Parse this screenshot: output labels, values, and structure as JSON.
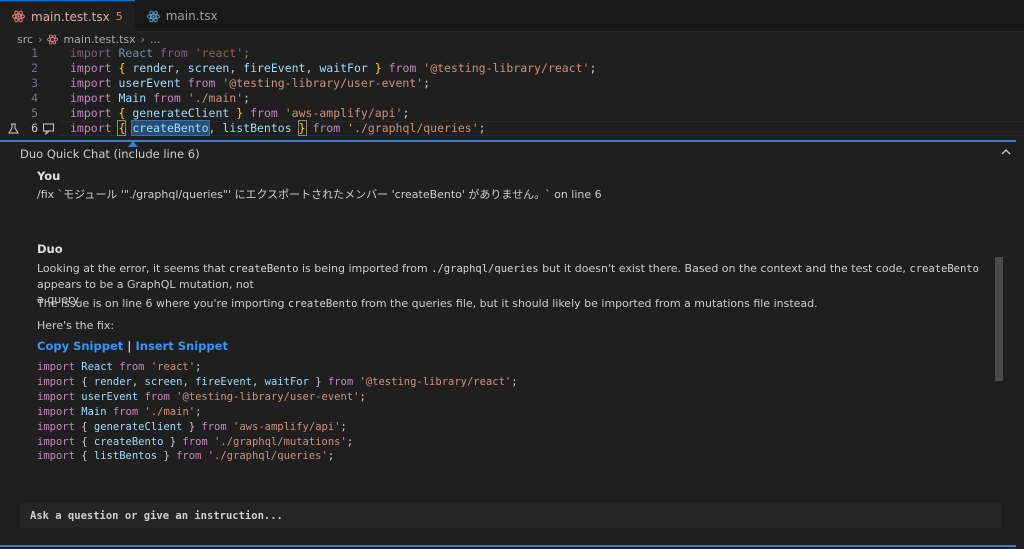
{
  "tabs": [
    {
      "label": "main.test.tsx",
      "badge": "5",
      "icon": "react-icon",
      "active": true
    },
    {
      "label": "main.tsx",
      "icon": "react-icon",
      "active": false
    }
  ],
  "breadcrumb": {
    "folder": "src",
    "file": "main.test.tsx",
    "more": "..."
  },
  "editor": {
    "lines": [
      {
        "n": "1",
        "tokens": [
          [
            "kw",
            "import"
          ],
          [
            "pl",
            " "
          ],
          [
            "id",
            "React"
          ],
          [
            "pl",
            " "
          ],
          [
            "kw",
            "from"
          ],
          [
            "pl",
            " "
          ],
          [
            "str",
            "'react'"
          ],
          [
            "pl",
            ";"
          ]
        ]
      },
      {
        "n": "2",
        "tokens": [
          [
            "kw",
            "import"
          ],
          [
            "pl",
            " "
          ],
          [
            "br",
            "{"
          ],
          [
            "pl",
            " "
          ],
          [
            "id",
            "render"
          ],
          [
            "pl",
            ", "
          ],
          [
            "id",
            "screen"
          ],
          [
            "pl",
            ", "
          ],
          [
            "id",
            "fireEvent"
          ],
          [
            "pl",
            ", "
          ],
          [
            "id",
            "waitFor"
          ],
          [
            "pl",
            " "
          ],
          [
            "br",
            "}"
          ],
          [
            "pl",
            " "
          ],
          [
            "kw",
            "from"
          ],
          [
            "pl",
            " "
          ],
          [
            "str",
            "'@testing-library/react'"
          ],
          [
            "pl",
            ";"
          ]
        ]
      },
      {
        "n": "3",
        "tokens": [
          [
            "kw",
            "import"
          ],
          [
            "pl",
            " "
          ],
          [
            "id",
            "userEvent"
          ],
          [
            "pl",
            " "
          ],
          [
            "kw",
            "from"
          ],
          [
            "pl",
            " "
          ],
          [
            "str",
            "'@testing-library/user-event'"
          ],
          [
            "pl",
            ";"
          ]
        ]
      },
      {
        "n": "4",
        "tokens": [
          [
            "kw",
            "import"
          ],
          [
            "pl",
            " "
          ],
          [
            "id",
            "Main"
          ],
          [
            "pl",
            " "
          ],
          [
            "kw",
            "from"
          ],
          [
            "pl",
            " "
          ],
          [
            "str",
            "'./main'"
          ],
          [
            "pl",
            ";"
          ]
        ]
      },
      {
        "n": "5",
        "tokens": [
          [
            "kw",
            "import"
          ],
          [
            "pl",
            " "
          ],
          [
            "br",
            "{"
          ],
          [
            "pl",
            " "
          ],
          [
            "id",
            "generateClient"
          ],
          [
            "pl",
            " "
          ],
          [
            "br",
            "}"
          ],
          [
            "pl",
            " "
          ],
          [
            "kw",
            "from"
          ],
          [
            "pl",
            " "
          ],
          [
            "str",
            "'aws-amplify/api'"
          ],
          [
            "pl",
            ";"
          ]
        ]
      },
      {
        "n": "6",
        "tokens": [
          [
            "kw",
            "import"
          ],
          [
            "pl",
            " "
          ],
          [
            "brbox",
            "{"
          ],
          [
            "pl",
            " "
          ],
          [
            "hl",
            "createBento"
          ],
          [
            "pl",
            ", "
          ],
          [
            "id",
            "listBentos"
          ],
          [
            "pl",
            " "
          ],
          [
            "brbox",
            "}"
          ],
          [
            "pl",
            " "
          ],
          [
            "kw",
            "from"
          ],
          [
            "pl",
            " "
          ],
          [
            "str",
            "'./graphql/queries'"
          ],
          [
            "pl",
            ";"
          ]
        ]
      }
    ]
  },
  "chat": {
    "title": "Duo Quick Chat (include line 6)",
    "user_author": "You",
    "user_message": "/fix `モジュール '\"./graphql/queries\"' にエクスポートされたメンバー 'createBento' がありません。` on line 6",
    "duo_author": "Duo",
    "p1": [
      [
        "t",
        "Looking at the error, it seems that "
      ],
      [
        "c",
        "createBento"
      ],
      [
        "t",
        " is being imported from "
      ],
      [
        "c",
        "./graphql/queries"
      ],
      [
        "t",
        " but it doesn't exist there. Based on the context and the test code, "
      ],
      [
        "c",
        "createBento"
      ],
      [
        "t",
        " appears to be a GraphQL mutation, not"
      ]
    ],
    "p1_cont": "a query.",
    "p2": [
      [
        "t",
        "The issue is on line 6 where you're importing "
      ],
      [
        "c",
        "createBento"
      ],
      [
        "t",
        " from the queries file, but it should likely be imported from a mutations file instead."
      ]
    ],
    "p3": "Here's the fix:",
    "copy_label": "Copy Snippet",
    "sep": "|",
    "insert_label": "Insert Snippet",
    "snippet": [
      [
        [
          "kw",
          "import"
        ],
        [
          "pl",
          " "
        ],
        [
          "id",
          "React"
        ],
        [
          "pl",
          " "
        ],
        [
          "kw",
          "from"
        ],
        [
          "pl",
          " "
        ],
        [
          "str",
          "'react'"
        ],
        [
          "pl",
          ";"
        ]
      ],
      [
        [
          "kw",
          "import"
        ],
        [
          "pl",
          " { "
        ],
        [
          "id",
          "render"
        ],
        [
          "pl",
          ", "
        ],
        [
          "id",
          "screen"
        ],
        [
          "pl",
          ", "
        ],
        [
          "id",
          "fireEvent"
        ],
        [
          "pl",
          ", "
        ],
        [
          "id",
          "waitFor"
        ],
        [
          "pl",
          " } "
        ],
        [
          "kw",
          "from"
        ],
        [
          "pl",
          " "
        ],
        [
          "str",
          "'@testing-library/react'"
        ],
        [
          "pl",
          ";"
        ]
      ],
      [
        [
          "kw",
          "import"
        ],
        [
          "pl",
          " "
        ],
        [
          "id",
          "userEvent"
        ],
        [
          "pl",
          " "
        ],
        [
          "kw",
          "from"
        ],
        [
          "pl",
          " "
        ],
        [
          "str",
          "'@testing-library/user-event'"
        ],
        [
          "pl",
          ";"
        ]
      ],
      [
        [
          "kw",
          "import"
        ],
        [
          "pl",
          " "
        ],
        [
          "id",
          "Main"
        ],
        [
          "pl",
          " "
        ],
        [
          "kw",
          "from"
        ],
        [
          "pl",
          " "
        ],
        [
          "str",
          "'./main'"
        ],
        [
          "pl",
          ";"
        ]
      ],
      [
        [
          "kw",
          "import"
        ],
        [
          "pl",
          " { "
        ],
        [
          "id",
          "generateClient"
        ],
        [
          "pl",
          " } "
        ],
        [
          "kw",
          "from"
        ],
        [
          "pl",
          " "
        ],
        [
          "str",
          "'aws-amplify/api'"
        ],
        [
          "pl",
          ";"
        ]
      ],
      [
        [
          "kw",
          "import"
        ],
        [
          "pl",
          " { "
        ],
        [
          "id",
          "createBento"
        ],
        [
          "pl",
          " } "
        ],
        [
          "kw",
          "from"
        ],
        [
          "pl",
          " "
        ],
        [
          "str",
          "'./graphql/mutations'"
        ],
        [
          "pl",
          ";"
        ]
      ],
      [
        [
          "kw",
          "import"
        ],
        [
          "pl",
          " { "
        ],
        [
          "id",
          "listBentos"
        ],
        [
          "pl",
          " } "
        ],
        [
          "kw",
          "from"
        ],
        [
          "pl",
          " "
        ],
        [
          "str",
          "'./graphql/queries'"
        ],
        [
          "pl",
          ";"
        ]
      ]
    ],
    "input_placeholder": "Ask a question or give an instruction..."
  },
  "colors": {
    "accent": "#2f7fd6",
    "link": "#3794ff",
    "keyword": "#c586c0",
    "identifier": "#9cdcfe",
    "string": "#ce9178",
    "error_tab": "#e07b7b"
  }
}
